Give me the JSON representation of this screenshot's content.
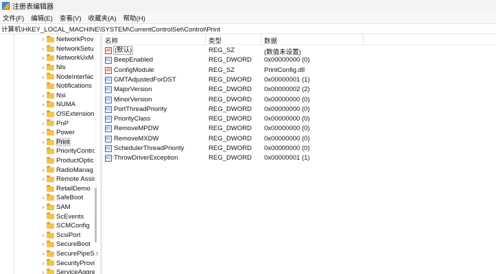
{
  "window": {
    "title": "注册表编辑器"
  },
  "menu": [
    "文件(F)",
    "编辑(E)",
    "查看(V)",
    "收藏夹(A)",
    "帮助(H)"
  ],
  "address": "计算机\\HKEY_LOCAL_MACHINE\\SYSTEM\\CurrentControlSet\\Control\\Print",
  "tree": {
    "items": [
      {
        "label": "NetworkProv",
        "expandable": true
      },
      {
        "label": "NetworkSetu",
        "expandable": true
      },
      {
        "label": "NetworkUxM",
        "expandable": true
      },
      {
        "label": "Nls",
        "expandable": true
      },
      {
        "label": "NodeInterfac",
        "expandable": true
      },
      {
        "label": "Notifications",
        "expandable": false
      },
      {
        "label": "Nsi",
        "expandable": true
      },
      {
        "label": "NUMA",
        "expandable": true
      },
      {
        "label": "OSExtensionI",
        "expandable": true
      },
      {
        "label": "PnP",
        "expandable": true
      },
      {
        "label": "Power",
        "expandable": true
      },
      {
        "label": "Print",
        "expandable": true,
        "selected": true
      },
      {
        "label": "PriorityContro",
        "expandable": false
      },
      {
        "label": "ProductOptic",
        "expandable": false
      },
      {
        "label": "RadioManag",
        "expandable": true
      },
      {
        "label": "Remote Assis",
        "expandable": true
      },
      {
        "label": "RetailDemo",
        "expandable": false
      },
      {
        "label": "SafeBoot",
        "expandable": true
      },
      {
        "label": "SAM",
        "expandable": true
      },
      {
        "label": "ScEvents",
        "expandable": false
      },
      {
        "label": "SCMConfig",
        "expandable": false
      },
      {
        "label": "ScsiPort",
        "expandable": true
      },
      {
        "label": "SecureBoot",
        "expandable": true
      },
      {
        "label": "SecurePipeSe",
        "expandable": true
      },
      {
        "label": "SecurityProvi",
        "expandable": true
      },
      {
        "label": "ServiceAggre",
        "expandable": true
      }
    ]
  },
  "list": {
    "headers": {
      "name": "名称",
      "type": "类型",
      "data": "数据"
    },
    "rows": [
      {
        "icon": "string-value-icon",
        "glyph": "ab",
        "name": "(默认)",
        "type": "REG_SZ",
        "data": "(数值未设置)",
        "default": true
      },
      {
        "icon": "dword-value-icon",
        "glyph": "011",
        "name": "BeepEnabled",
        "type": "REG_DWORD",
        "data": "0x00000000 (0)"
      },
      {
        "icon": "string-value-icon",
        "glyph": "ab",
        "name": "ConfigModule",
        "type": "REG_SZ",
        "data": "PrintConfig.dll"
      },
      {
        "icon": "dword-value-icon",
        "glyph": "011",
        "name": "GMTAdjustedForDST",
        "type": "REG_DWORD",
        "data": "0x00000001 (1)"
      },
      {
        "icon": "dword-value-icon",
        "glyph": "011",
        "name": "MajorVersion",
        "type": "REG_DWORD",
        "data": "0x00000002 (2)"
      },
      {
        "icon": "dword-value-icon",
        "glyph": "011",
        "name": "MinorVersion",
        "type": "REG_DWORD",
        "data": "0x00000000 (0)"
      },
      {
        "icon": "dword-value-icon",
        "glyph": "011",
        "name": "PortThreadPriority",
        "type": "REG_DWORD",
        "data": "0x00000000 (0)"
      },
      {
        "icon": "dword-value-icon",
        "glyph": "011",
        "name": "PriorityClass",
        "type": "REG_DWORD",
        "data": "0x00000000 (0)"
      },
      {
        "icon": "dword-value-icon",
        "glyph": "011",
        "name": "RemoveMPDW",
        "type": "REG_DWORD",
        "data": "0x00000000 (0)"
      },
      {
        "icon": "dword-value-icon",
        "glyph": "011",
        "name": "RemoveMXDW",
        "type": "REG_DWORD",
        "data": "0x00000000 (0)"
      },
      {
        "icon": "dword-value-icon",
        "glyph": "011",
        "name": "SchedulerThreadPriority",
        "type": "REG_DWORD",
        "data": "0x00000000 (0)"
      },
      {
        "icon": "dword-value-icon",
        "glyph": "011",
        "name": "ThrowDriverException",
        "type": "REG_DWORD",
        "data": "0x00000001 (1)"
      }
    ]
  }
}
